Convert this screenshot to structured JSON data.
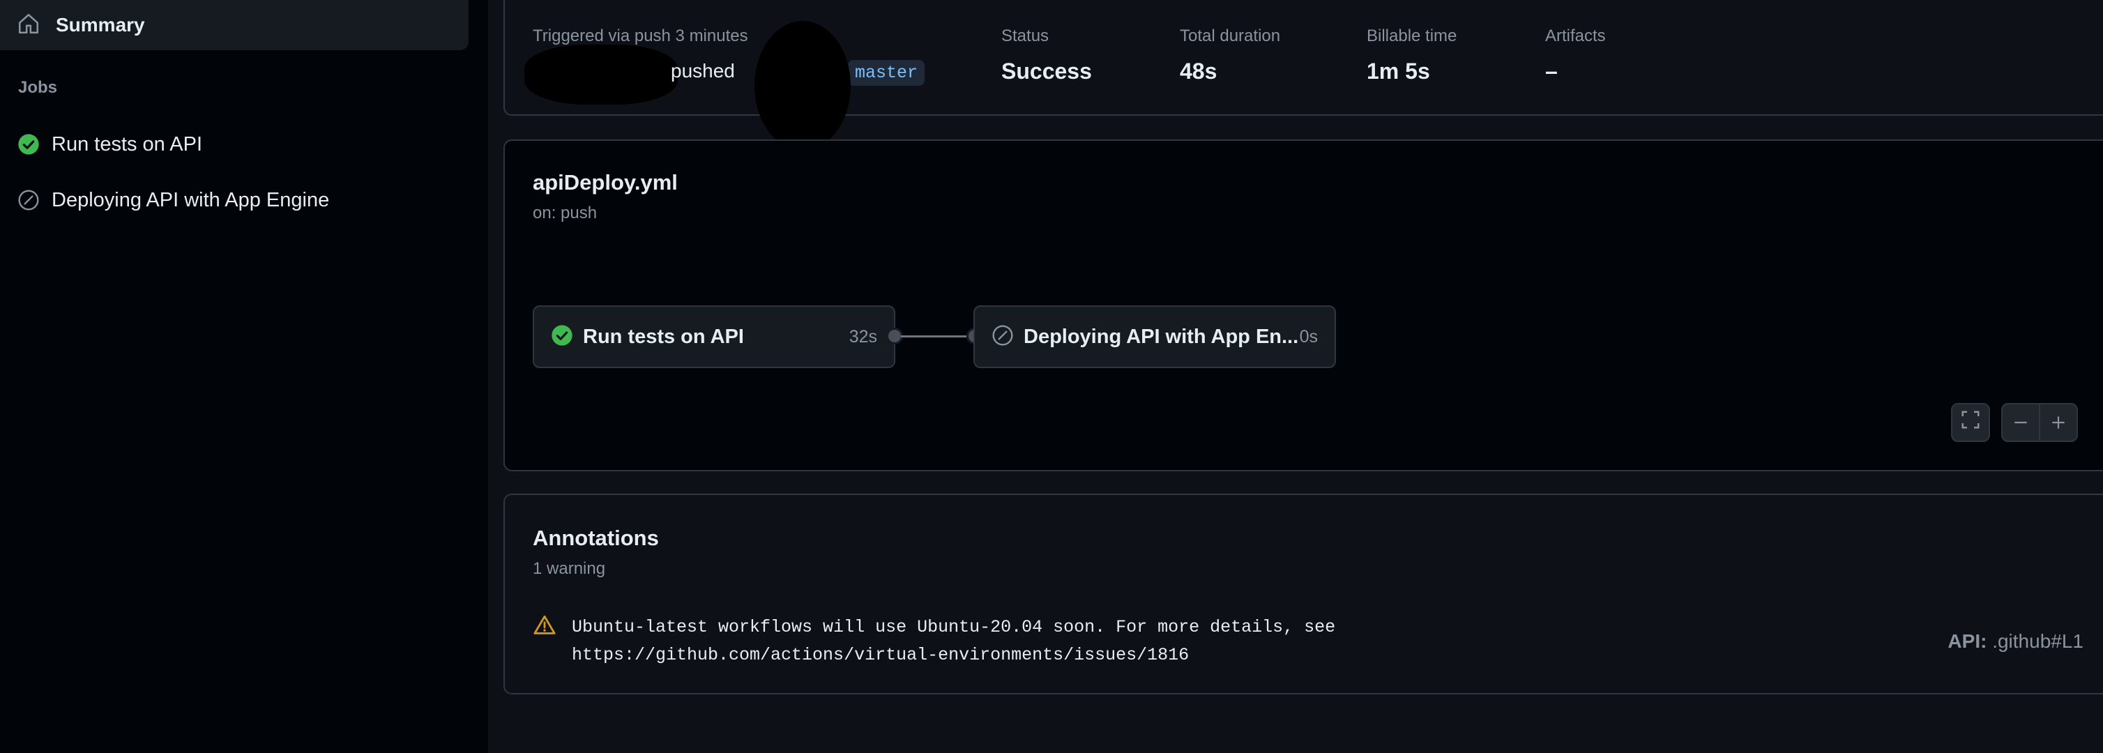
{
  "sidebar": {
    "summary_label": "Summary",
    "jobs_heading": "Jobs",
    "jobs": [
      {
        "label": "Run tests on API",
        "status": "success"
      },
      {
        "label": "Deploying API with App Engine",
        "status": "skipped"
      }
    ]
  },
  "run": {
    "trigger_text": "Triggered via push 3 minutes",
    "pushed_text": "pushed",
    "branch": "master",
    "status_label": "Status",
    "status_value": "Success",
    "duration_label": "Total duration",
    "duration_value": "48s",
    "billable_label": "Billable time",
    "billable_value": "1m 5s",
    "artifacts_label": "Artifacts",
    "artifacts_value": "–"
  },
  "workflow": {
    "file": "apiDeploy.yml",
    "trigger": "on: push",
    "jobs": [
      {
        "name": "Run tests on API",
        "duration": "32s",
        "icon": "check-circle-icon"
      },
      {
        "name": "Deploying API with App En...",
        "duration": "0s",
        "icon": "skip-icon"
      }
    ],
    "controls": [
      "fullscreen-icon",
      "zoom-out-icon",
      "zoom-in-icon"
    ]
  },
  "annotations": {
    "title": "Annotations",
    "count": "1 warning",
    "items": [
      {
        "icon": "warning-icon",
        "message": "Ubuntu-latest workflows will use Ubuntu-20.04 soon. For more details, see https://github.com/actions/virtual-environments/issues/1816",
        "location_prefix": "API:",
        "location": ".github#L1"
      }
    ]
  },
  "colors": {
    "success": "#3fb950",
    "warning": "#d29922",
    "muted": "#8b949e",
    "background": "#0d1117"
  }
}
